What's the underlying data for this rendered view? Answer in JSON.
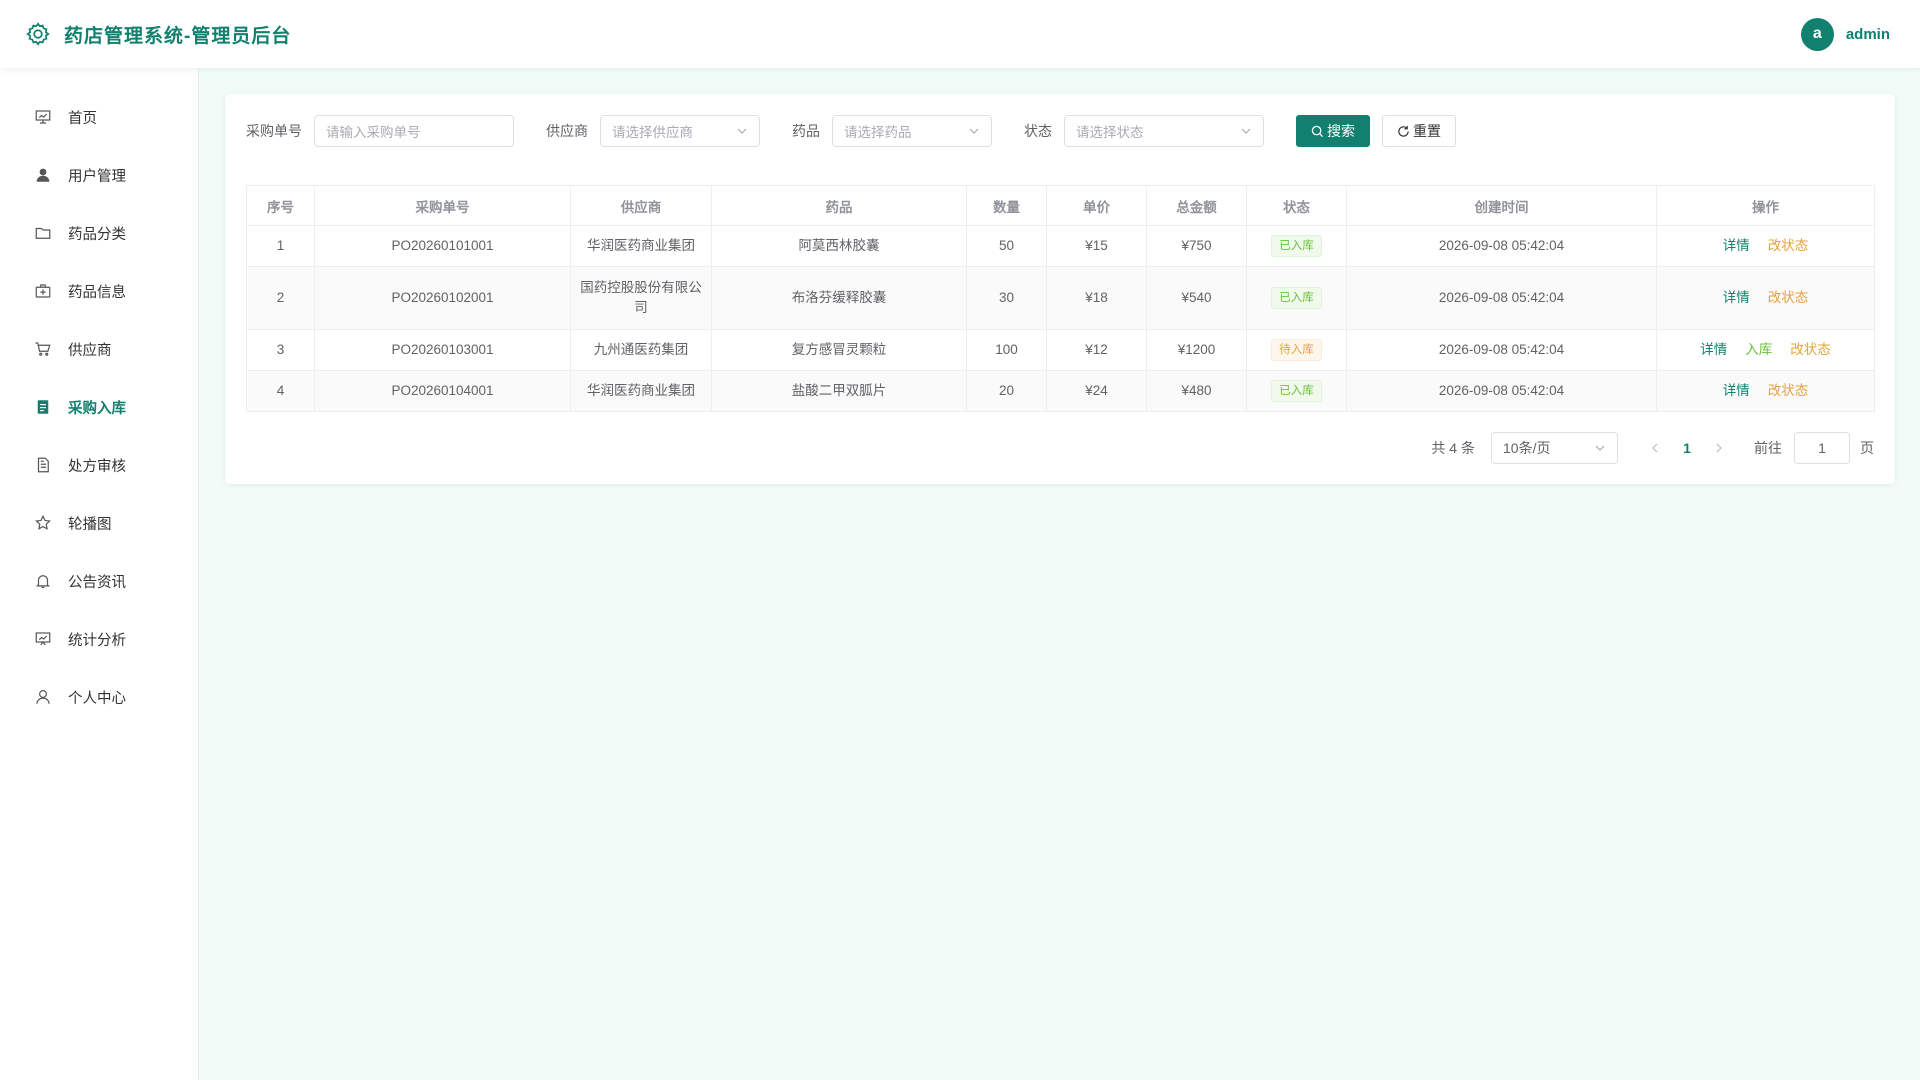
{
  "header": {
    "title": "药店管理系统-管理员后台",
    "avatar_letter": "a",
    "username": "admin"
  },
  "colors": {
    "accent": "#11806e",
    "success": "#67c23a",
    "warning": "#e6a23c",
    "background": "#f1fcf8"
  },
  "sidebar": {
    "active": "采购入库",
    "items": [
      {
        "label": "首页",
        "icon": "dashboard-icon"
      },
      {
        "label": "用户管理",
        "icon": "user-filled-icon"
      },
      {
        "label": "药品分类",
        "icon": "folder-icon"
      },
      {
        "label": "药品信息",
        "icon": "first-aid-kit-icon"
      },
      {
        "label": "供应商",
        "icon": "shopping-cart-icon"
      },
      {
        "label": "采购入库",
        "icon": "document-filled-icon"
      },
      {
        "label": "处方审核",
        "icon": "document-icon"
      },
      {
        "label": "轮播图",
        "icon": "star-icon"
      },
      {
        "label": "公告资讯",
        "icon": "bell-icon"
      },
      {
        "label": "统计分析",
        "icon": "presentation-icon"
      },
      {
        "label": "个人中心",
        "icon": "user-icon"
      }
    ]
  },
  "search": {
    "order_no_label": "采购单号",
    "order_no_placeholder": "请输入采购单号",
    "supplier_label": "供应商",
    "supplier_placeholder": "请选择供应商",
    "drug_label": "药品",
    "drug_placeholder": "请选择药品",
    "status_label": "状态",
    "status_placeholder": "请选择状态",
    "search_button": "搜索",
    "reset_button": "重置"
  },
  "table": {
    "columns": [
      "序号",
      "采购单号",
      "供应商",
      "药品",
      "数量",
      "单价",
      "总金额",
      "状态",
      "创建时间",
      "操作"
    ],
    "rows": [
      {
        "index": "1",
        "order_no": "PO20260101001",
        "supplier": "华润医药商业集团",
        "drug": "阿莫西林胶囊",
        "quantity": "50",
        "unit_price": "¥15",
        "total": "¥750",
        "status": "已入库",
        "created": "2026-09-08 05:42:04"
      },
      {
        "index": "2",
        "order_no": "PO20260102001",
        "supplier": "国药控股股份有限公司",
        "drug": "布洛芬缓释胶囊",
        "quantity": "30",
        "unit_price": "¥18",
        "total": "¥540",
        "status": "已入库",
        "created": "2026-09-08 05:42:04"
      },
      {
        "index": "3",
        "order_no": "PO20260103001",
        "supplier": "九州通医药集团",
        "drug": "复方感冒灵颗粒",
        "quantity": "100",
        "unit_price": "¥12",
        "total": "¥1200",
        "status": "待入库",
        "created": "2026-09-08 05:42:04"
      },
      {
        "index": "4",
        "order_no": "PO20260104001",
        "supplier": "华润医药商业集团",
        "drug": "盐酸二甲双胍片",
        "quantity": "20",
        "unit_price": "¥24",
        "total": "¥480",
        "status": "已入库",
        "created": "2026-09-08 05:42:04"
      }
    ],
    "actions": {
      "detail": "详情",
      "stock_in": "入库",
      "change_status": "改状态"
    }
  },
  "pagination": {
    "total_text": "共 4 条",
    "page_size": "10条/页",
    "current_page": "1",
    "goto_label": "前往",
    "goto_value": "1",
    "page_suffix": "页"
  }
}
